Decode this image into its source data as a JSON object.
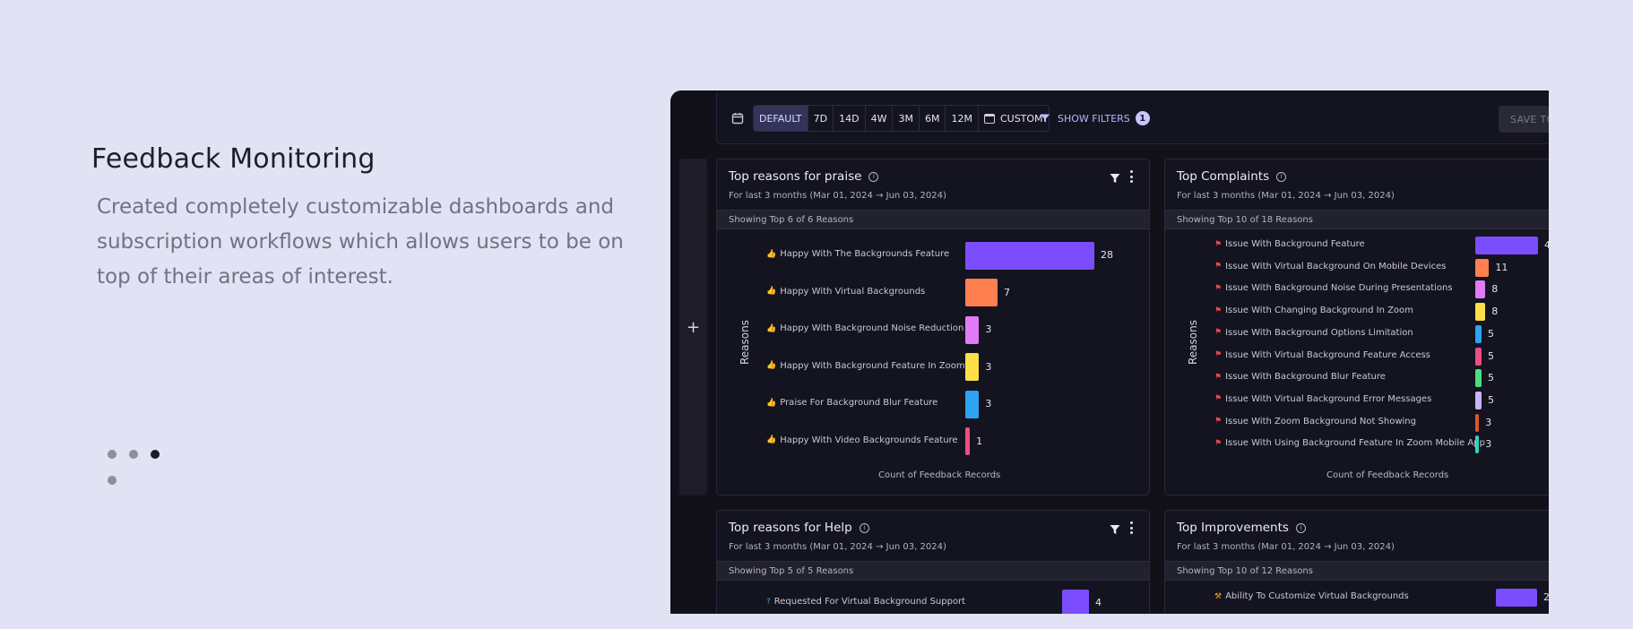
{
  "hero": {
    "title": "Feedback Monitoring",
    "description": "Created completely customizable dashboards and subscription workflows which allows users to be on top of their areas of interest."
  },
  "carousel": {
    "active_index": 2
  },
  "toolbar": {
    "ranges": [
      "DEFAULT",
      "7D",
      "14D",
      "4W",
      "3M",
      "6M",
      "12M"
    ],
    "active_range": "DEFAULT",
    "custom_label": "CUSTOM",
    "show_filters_label": "SHOW FILTERS",
    "filter_count": "1",
    "save_label": "SAVE TO DASHBOARD",
    "add_label": "+"
  },
  "colors": {
    "purple": "#7c4dff",
    "orange": "#ff7f50",
    "violet": "#e07bf5",
    "yellow": "#fde047",
    "blue": "#2ea3f2",
    "pink": "#ec4d85",
    "green": "#4ade80",
    "lavender": "#c4b5fd",
    "red": "#e0542b",
    "teal": "#2dd4bf",
    "praise_icon": "#4caf50",
    "complaint_icon": "#e84b4b",
    "help_icon": "#3fa9f5",
    "improvement_icon": "#f5a623"
  },
  "cards": [
    {
      "title": "Top reasons for praise",
      "subtitle": "For last 3 months (Mar 01, 2024 → Jun 03, 2024)",
      "showing": "Showing Top 6 of 6 Reasons",
      "yaxis": "Reasons",
      "xaxis": "Count of Feedback Records",
      "has_actions": true,
      "icon": "thumbs-up-icon",
      "icon_glyph": "👍",
      "rows": [
        {
          "label": "Happy With The Backgrounds Feature",
          "value": 28,
          "color": "#7c4dff"
        },
        {
          "label": "Happy With Virtual Backgrounds",
          "value": 7,
          "color": "#ff7f50"
        },
        {
          "label": "Happy With Background Noise Reduction",
          "value": 3,
          "color": "#e07bf5"
        },
        {
          "label": "Happy With Background Feature In Zoom",
          "value": 3,
          "color": "#fde047"
        },
        {
          "label": "Praise For Background Blur Feature",
          "value": 3,
          "color": "#2ea3f2"
        },
        {
          "label": "Happy With Video Backgrounds Feature",
          "value": 1,
          "color": "#ec4d85"
        }
      ]
    },
    {
      "title": "Top Complaints",
      "subtitle": "For last 3 months (Mar 01, 2024 → Jun 03, 2024)",
      "showing": "Showing Top 10 of 18 Reasons",
      "yaxis": "Reasons",
      "xaxis": "Count of Feedback Records",
      "has_actions": false,
      "icon": "flag-icon",
      "icon_glyph": "⚑",
      "rows": [
        {
          "label": "Issue With Background Feature",
          "value": 4,
          "color": "#7c4dff"
        },
        {
          "label": "Issue With Virtual Background On Mobile Devices",
          "value": 11,
          "color": "#ff7f50"
        },
        {
          "label": "Issue With Background Noise During Presentations",
          "value": 8,
          "color": "#e07bf5"
        },
        {
          "label": "Issue With Changing Background In Zoom",
          "value": 8,
          "color": "#fde047"
        },
        {
          "label": "Issue With Background Options Limitation",
          "value": 5,
          "color": "#2ea3f2"
        },
        {
          "label": "Issue With Virtual Background Feature Access",
          "value": 5,
          "color": "#ec4d85"
        },
        {
          "label": "Issue With Background Blur Feature",
          "value": 5,
          "color": "#4ade80"
        },
        {
          "label": "Issue With Virtual Background Error Messages",
          "value": 5,
          "color": "#c4b5fd"
        },
        {
          "label": "Issue With Zoom Background Not Showing",
          "value": 3,
          "color": "#e0542b"
        },
        {
          "label": "Issue With Using Background Feature In Zoom Mobile App",
          "value": 3,
          "color": "#2dd4bf"
        }
      ]
    },
    {
      "title": "Top reasons for Help",
      "subtitle": "For last 3 months (Mar 01, 2024 → Jun 03, 2024)",
      "showing": "Showing Top 5 of 5 Reasons",
      "yaxis": "",
      "xaxis": "",
      "has_actions": true,
      "icon": "help-icon",
      "icon_glyph": "?",
      "rows": [
        {
          "label": "Requested For Virtual Background Support",
          "value": 4,
          "color": "#7c4dff"
        }
      ]
    },
    {
      "title": "Top Improvements",
      "subtitle": "For last 3 months (Mar 01, 2024 → Jun 03, 2024)",
      "showing": "Showing Top 10 of 12 Reasons",
      "yaxis": "",
      "xaxis": "",
      "has_actions": false,
      "icon": "tools-icon",
      "icon_glyph": "⚒",
      "rows": [
        {
          "label": "Ability To Customize Virtual Backgrounds",
          "value": 2,
          "color": "#7c4dff"
        }
      ]
    }
  ]
}
